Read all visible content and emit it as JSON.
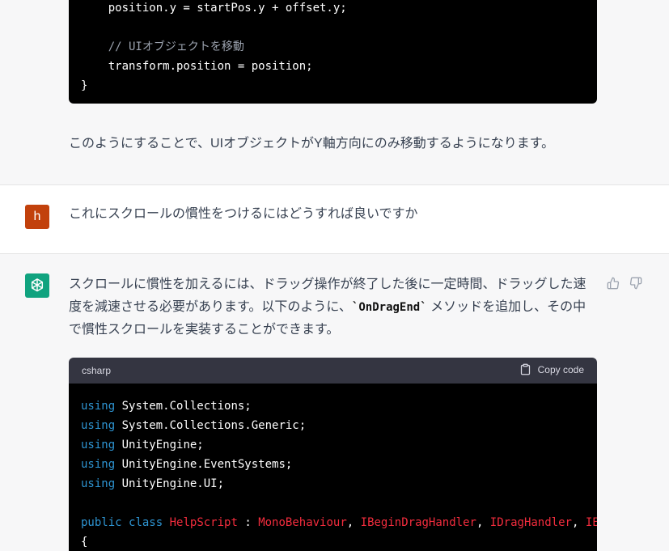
{
  "top_code": {
    "lines": [
      "    position.y = startPos.y + offset.y;",
      "",
      "    // UIオブジェクトを移動",
      "    transform.position = position;",
      "}"
    ]
  },
  "assistant_msg_1": {
    "text": "このようにすることで、UIオブジェクトがY軸方向にのみ移動するようになります。"
  },
  "user_msg": {
    "avatar_letter": "h",
    "text": "これにスクロールの慣性をつけるにはどうすれば良いですか"
  },
  "assistant_msg_2": {
    "line1": "スクロールに慣性を加えるには、ドラッグ操作が終了した後に一定時間、ドラッグした速",
    "line2_a": "度を減速させる必要があります。以下のように、",
    "line2_code": "`OnDragEnd`",
    "line2_b": " メソッドを追加し、その中",
    "line3": "で慣性スクロールを実装することができます。"
  },
  "code_block": {
    "language": "csharp",
    "copy_label": "Copy code",
    "using_kw": "using",
    "usings": [
      "System.Collections;",
      "System.Collections.Generic;",
      "UnityEngine;",
      "UnityEngine.EventSystems;",
      "UnityEngine.UI;"
    ],
    "class_line": {
      "public_kw": "public",
      "class_kw": "class",
      "class_name": "HelpScript",
      "sep": " : ",
      "base1": "MonoBehaviour",
      "comma": ", ",
      "base2": "IBeginDragHandler",
      "base3": "IDragHandler",
      "base4_partial": "IE"
    },
    "open_brace": "{"
  },
  "colors": {
    "user_avatar_bg": "#c2410c",
    "assistant_avatar_bg": "#10a37f",
    "keyword": "#2e95d3",
    "type": "#f22c3d"
  }
}
